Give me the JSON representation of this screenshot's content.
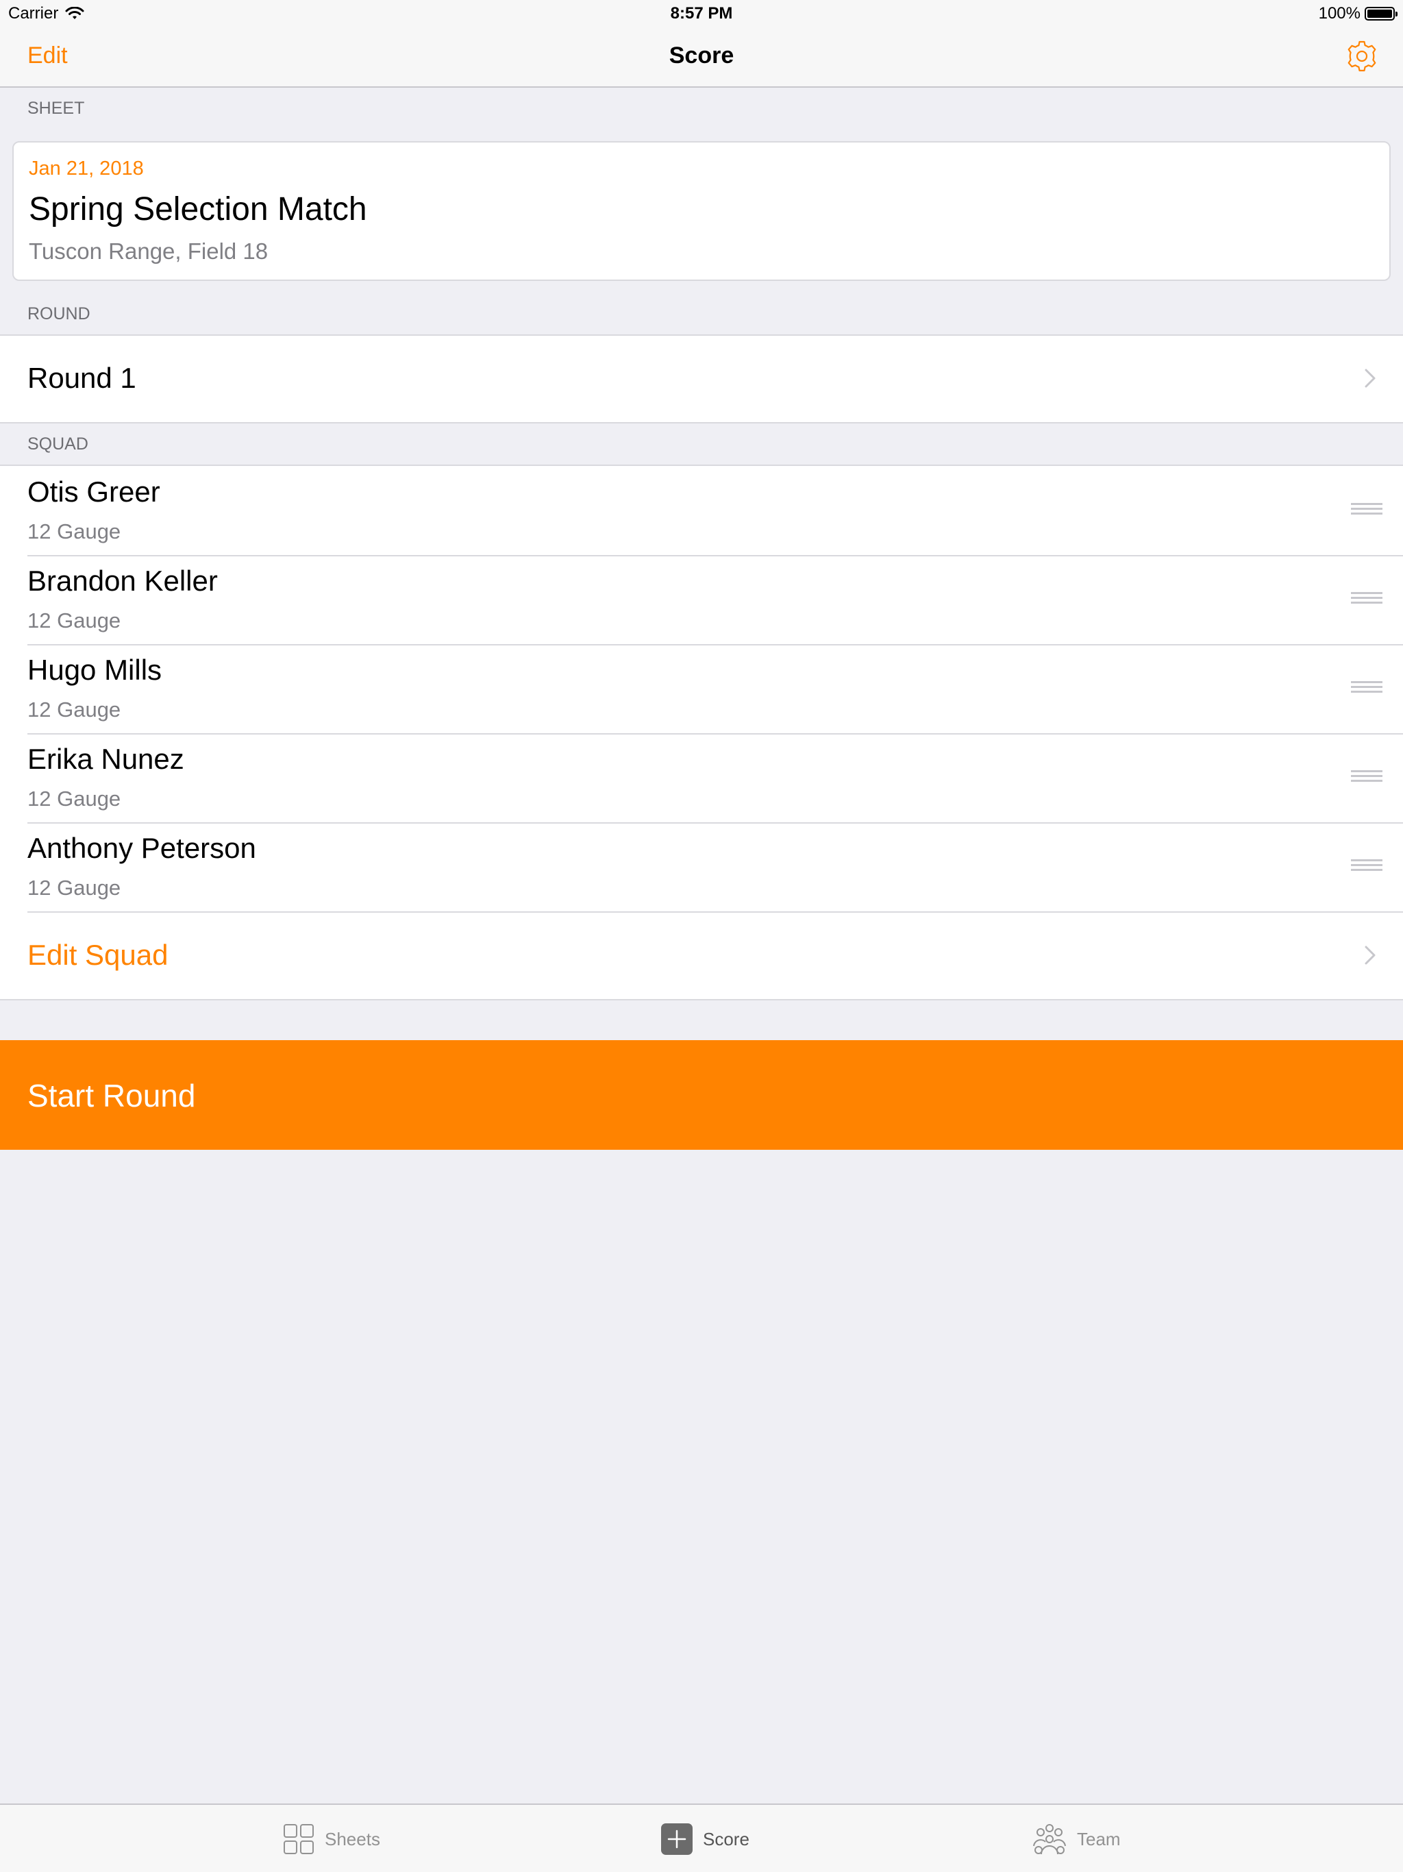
{
  "status_bar": {
    "carrier": "Carrier",
    "time": "8:57 PM",
    "battery": "100%"
  },
  "nav": {
    "edit_label": "Edit",
    "title": "Score",
    "settings_icon": "gear-icon"
  },
  "colors": {
    "accent": "#ff8300",
    "background": "#efeff4"
  },
  "sheet": {
    "header": "SHEET",
    "date": "Jan 21, 2018",
    "title": "Spring Selection Match",
    "location": "Tuscon Range, Field 18"
  },
  "round": {
    "header": "ROUND",
    "label": "Round 1"
  },
  "squad": {
    "header": "SQUAD",
    "members": [
      {
        "name": "Otis Greer",
        "gauge": "12 Gauge"
      },
      {
        "name": "Brandon Keller",
        "gauge": "12 Gauge"
      },
      {
        "name": "Hugo Mills",
        "gauge": "12 Gauge"
      },
      {
        "name": "Erika Nunez",
        "gauge": "12 Gauge"
      },
      {
        "name": "Anthony Peterson",
        "gauge": "12 Gauge"
      }
    ],
    "edit_label": "Edit Squad"
  },
  "start_round_label": "Start Round",
  "tabs": [
    {
      "label": "Sheets",
      "icon": "grid-icon"
    },
    {
      "label": "Score",
      "icon": "plus-square-icon",
      "selected": true
    },
    {
      "label": "Team",
      "icon": "team-icon"
    }
  ]
}
